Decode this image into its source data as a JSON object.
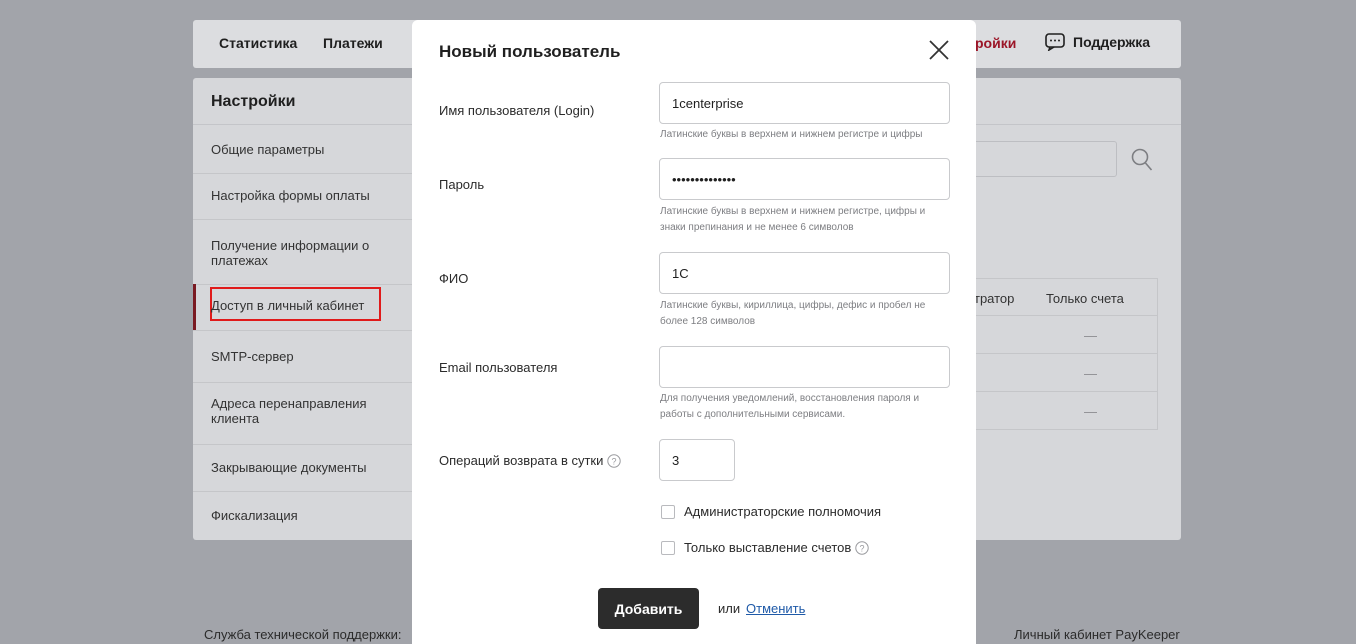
{
  "topnav": {
    "stats": "Статистика",
    "payments": "Платежи",
    "settings": "ройки",
    "support": "Поддержка"
  },
  "settings_panel": {
    "title": "Настройки",
    "items": [
      "Общие параметры",
      "Настройка формы оплаты",
      "Получение информации о платежах",
      "Доступ в личный кабинет",
      "SMTP-сервер",
      "Адреса перенаправления клиента",
      "Закрывающие документы",
      "Фискализация"
    ],
    "active_index": 3
  },
  "table": {
    "headers": [
      "тратор",
      "Только счета"
    ],
    "rows": [
      "—",
      "—",
      "—"
    ]
  },
  "footer": {
    "left": "Служба технической поддержки:",
    "right": "Личный кабинет PayKeeper"
  },
  "modal": {
    "title": "Новый пользователь",
    "fields": {
      "login": {
        "label": "Имя пользователя (Login)",
        "value": "1centerprise",
        "hint": "Латинские буквы в верхнем и нижнем регистре и цифры"
      },
      "password": {
        "label": "Пароль",
        "value": "••••••••••••••",
        "hint": "Латинские буквы в верхнем и нижнем регистре, цифры и знаки препинания и не менее 6 символов"
      },
      "fio": {
        "label": "ФИО",
        "value": "1С",
        "hint": "Латинские буквы, кириллица, цифры, дефис и пробел не более 128 символов"
      },
      "email": {
        "label": "Email пользователя",
        "value": "",
        "hint": "Для получения уведомлений, восстановления пароля и работы с дополнительными сервисами."
      },
      "refunds": {
        "label": "Операций возврата в сутки",
        "value": "3"
      }
    },
    "checkboxes": {
      "admin": "Администраторские полномочия",
      "invoices_only": "Только выставление счетов"
    },
    "add_button": "Добавить",
    "or_text": "или",
    "cancel_link": "Отменить"
  }
}
